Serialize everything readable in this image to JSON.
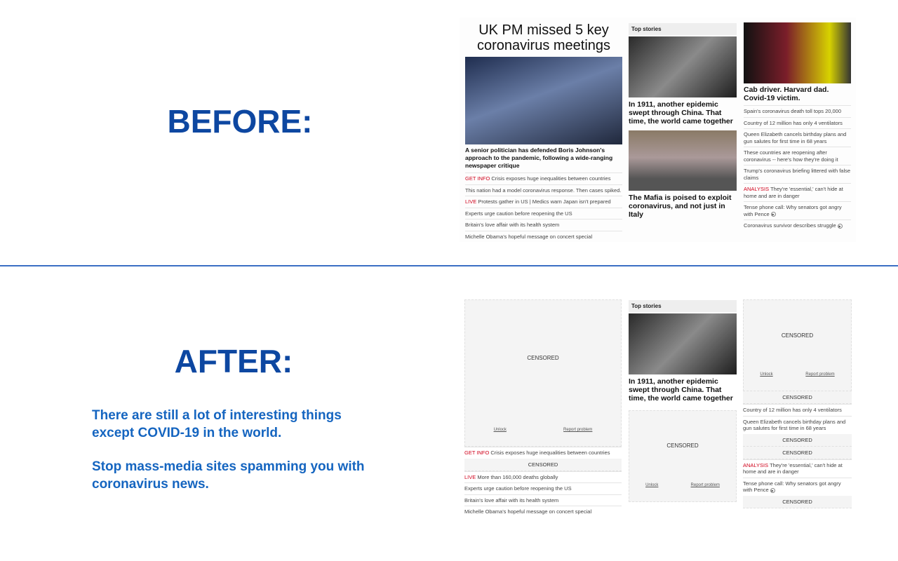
{
  "labels": {
    "before": "BEFORE:",
    "after": "AFTER:"
  },
  "promo": {
    "line1": "There are still a lot of interesting things except COVID-19 in the world.",
    "line2": "Stop mass-media sites spamming you with coronavirus news."
  },
  "colors": {
    "heading": "#0d47a1",
    "text": "#1565c0",
    "divider": "#3b6fc4",
    "tag": "#d0021b"
  },
  "before": {
    "col1": {
      "headline": "UK PM missed 5 key coronavirus meetings",
      "caption": "A senior politician has defended Boris Johnson's approach to the pandemic, following a wide-ranging newspaper critique",
      "items": [
        {
          "tag": "GET INFO",
          "text": " Crisis exposes huge inequalities between countries"
        },
        {
          "tag": "",
          "text": "This nation had a model coronavirus response. Then cases spiked."
        },
        {
          "tag": "LIVE",
          "text": " Protests gather in US | Medics warn Japan isn't prepared"
        },
        {
          "tag": "",
          "text": "Experts urge caution before reopening the US"
        },
        {
          "tag": "",
          "text": "Britain's love affair with its health system"
        },
        {
          "tag": "",
          "text": "Michelle Obama's hopeful message on concert special"
        }
      ]
    },
    "col2": {
      "top_stories": "Top stories",
      "headline1": "In 1911, another epidemic swept through China. That time, the world came together",
      "headline2": "The Mafia is poised to exploit coronavirus, and not just in Italy"
    },
    "col3": {
      "headline": "Cab driver. Harvard dad. Covid-19 victim.",
      "items": [
        {
          "tag": "",
          "text": "Spain's coronavirus death toll tops 20,000"
        },
        {
          "tag": "",
          "text": "Country of 12 million has only 4 ventilators"
        },
        {
          "tag": "",
          "text": "Queen Elizabeth cancels birthday plans and gun salutes for first time in 68 years"
        },
        {
          "tag": "",
          "text": "These countries are reopening after coronavirus -- here's how they're doing it"
        },
        {
          "tag": "",
          "text": "Trump's coronavirus briefing littered with false claims"
        },
        {
          "tag": "ANALYSIS",
          "text": " They're 'essential,' can't hide at home and are in danger"
        },
        {
          "tag": "",
          "text": "Tense phone call: Why senators got angry with Pence",
          "video": true
        },
        {
          "tag": "",
          "text": "Coronavirus survivor describes struggle",
          "video": true
        }
      ]
    }
  },
  "after": {
    "censored": "CENSORED",
    "unlock": "Unlock",
    "report": "Report problem",
    "col1": {
      "items": [
        {
          "tag": "GET INFO",
          "text": " Crisis exposes huge inequalities between countries"
        },
        {
          "tag": "LIVE",
          "text": " More than 160,000 deaths globally"
        },
        {
          "tag": "",
          "text": "Experts urge caution before reopening the US"
        },
        {
          "tag": "",
          "text": "Britain's love affair with its health system"
        },
        {
          "tag": "",
          "text": "Michelle Obama's hopeful message on concert special"
        }
      ]
    },
    "col2": {
      "top_stories": "Top stories",
      "headline1": "In 1911, another epidemic swept through China. That time, the world came together"
    },
    "col3": {
      "items": [
        {
          "tag": "",
          "text": "Country of 12 million has only 4 ventilators"
        },
        {
          "tag": "",
          "text": "Queen Elizabeth cancels birthday plans and gun salutes for first time in 68 years"
        },
        {
          "tag": "ANALYSIS",
          "text": " They're 'essential,' can't hide at home and are in danger"
        },
        {
          "tag": "",
          "text": "Tense phone call: Why senators got angry with Pence",
          "video": true
        }
      ]
    }
  }
}
